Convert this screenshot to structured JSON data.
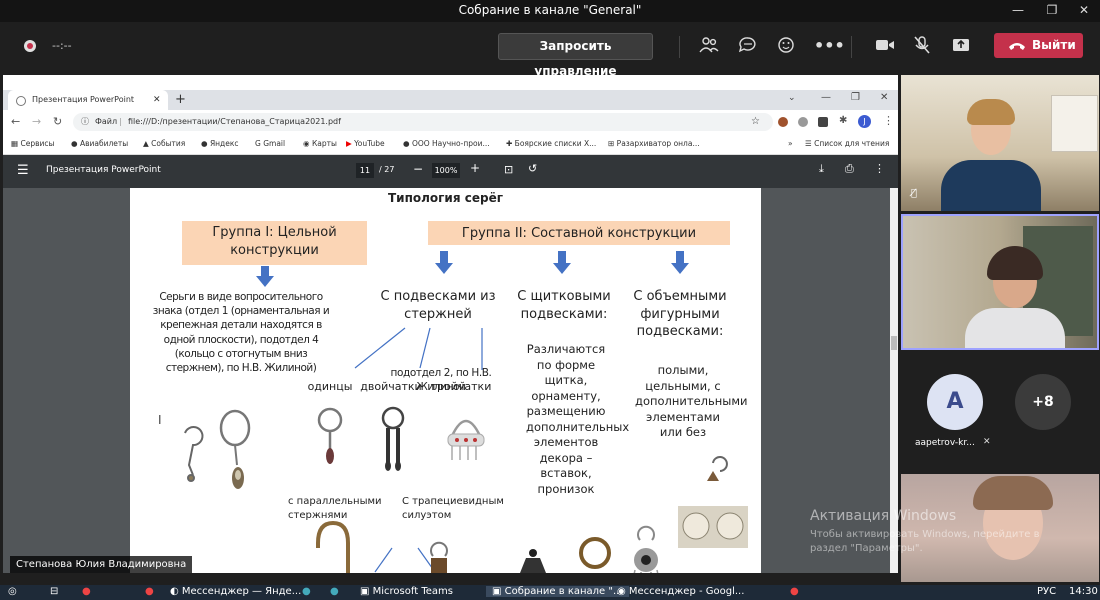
{
  "teams": {
    "window_title": "Собрание в канале \"General\"",
    "recording_time": "--:--",
    "request_control": "Запросить управление",
    "leave": "Выйти"
  },
  "browser": {
    "tab_title": "Презентация PowerPoint",
    "url_prefix": "Файл",
    "url": "file:///D:/презентации/Степанова_Старица2021.pdf",
    "profile_initial": "J",
    "bookmarks": [
      "Сервисы",
      "Авиабилеты",
      "События",
      "Яндекс",
      "Gmail",
      "Карты",
      "YouTube",
      "ООО Научно-прои...",
      "Боярские списки Х...",
      "Разархиватор онла..."
    ],
    "reading_list": "Список для чтения"
  },
  "pdf": {
    "title": "Презентация PowerPoint",
    "page_current": "11",
    "page_total": "/ 27",
    "zoom": "100%"
  },
  "slide": {
    "title": "Типология серёг",
    "group1": "Группа I: Цельной конструкции",
    "group2": "Группа II: Составной конструкции",
    "g1_desc": "Серьги в виде вопросительного знака (отдел 1 (орнаментальная и крепежная детали находятся в одной плоскости), подотдел 4 (кольцо с отогнутым вниз стержнем), по Н.В. Жилиной)",
    "col1": "С подвесками из стержней",
    "col2": "С щитковыми подвесками:",
    "col3": "С объемными фигурными подвесками:",
    "subdept": "подотдел 2, по Н.В. Жилиной",
    "odintsy": "одинцы",
    "dvoichatki": "двойчатки",
    "troichatki": "тройчатки",
    "parallel": "с параллельными стержнями",
    "trapez": "С трапециевидным силуэтом",
    "col2_desc": "Различаются по форме щитка, орнаменту, размещению дополнительных элементов декора – вставок, пронизок",
    "col3_desc": "полыми, цельными, с дополнительными элементами или без"
  },
  "presenter": "Степанова Юлия Владимировна",
  "participants": {
    "avatar_letter": "A",
    "avatar_name": "aapetrov-kr...",
    "more_count": "+8"
  },
  "watermark": {
    "line1": "Активация Windows",
    "line2": "Чтобы активировать Windows, перейдите в раздел \"Параметры\"."
  },
  "taskbar": {
    "items": [
      "Мессенджер — Яндe...",
      "Microsoft Teams",
      "Собрание в канале \"...",
      "Мессенджер - Googl..."
    ],
    "lang": "РУС",
    "time": "14:30"
  },
  "colors": {
    "leave": "#c4314b",
    "peach": "#fbd5b5",
    "arrow": "#4472c4"
  }
}
